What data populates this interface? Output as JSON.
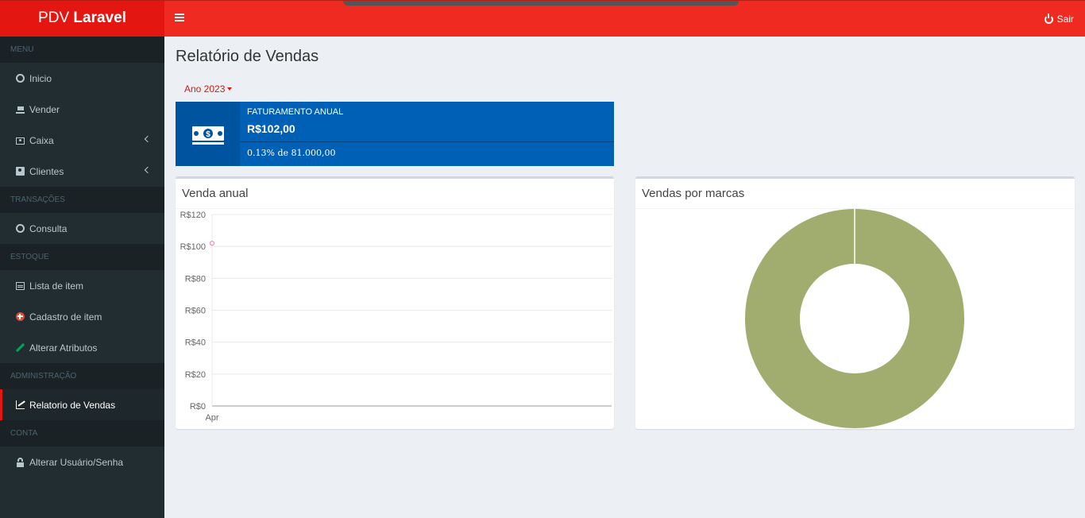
{
  "brand": {
    "prefix": "PDV",
    "name": "Laravel"
  },
  "header": {
    "logout_label": "Sair"
  },
  "sidebar": {
    "sections": {
      "menu": "MENU",
      "transacoes": "TRANSAÇÕES",
      "estoque": "ESTOQUE",
      "administracao": "ADMINISTRAÇÃO",
      "conta": "CONTA"
    },
    "items": {
      "inicio": "Inicio",
      "vender": "Vender",
      "caixa": "Caixa",
      "clientes": "Clientes",
      "consulta": "Consulta",
      "lista": "Lista de item",
      "cadastro": "Cadastro de item",
      "atributos": "Alterar Atributos",
      "relatorio": "Relatorio de Vendas",
      "usuario": "Alterar Usuário/Senha"
    }
  },
  "main": {
    "title": "Relatório de Vendas",
    "year_filter": "Ano 2023"
  },
  "infobox": {
    "label": "FATURAMENTO ANUAL",
    "value": "R$102,00",
    "progress_text": "0.13% de 81.000,00",
    "progress_fraction": 0.0013
  },
  "panels": {
    "line_title": "Venda anual",
    "donut_title": "Vendas por marcas"
  },
  "colors": {
    "accent": "#ef2a20",
    "infobox": "#0060b6",
    "donut": "#a0ad6e",
    "point": "#f08ca8"
  },
  "chart_data": [
    {
      "type": "line",
      "x": [
        "Apr"
      ],
      "series": [
        {
          "values": [
            102
          ]
        }
      ],
      "yticks": [
        "R$0",
        "R$20",
        "R$40",
        "R$60",
        "R$80",
        "R$100",
        "R$120"
      ],
      "ylim": [
        0,
        120
      ],
      "grid": true
    },
    {
      "type": "pie",
      "donut": true,
      "labels": [
        ""
      ],
      "values": [
        102
      ]
    }
  ]
}
